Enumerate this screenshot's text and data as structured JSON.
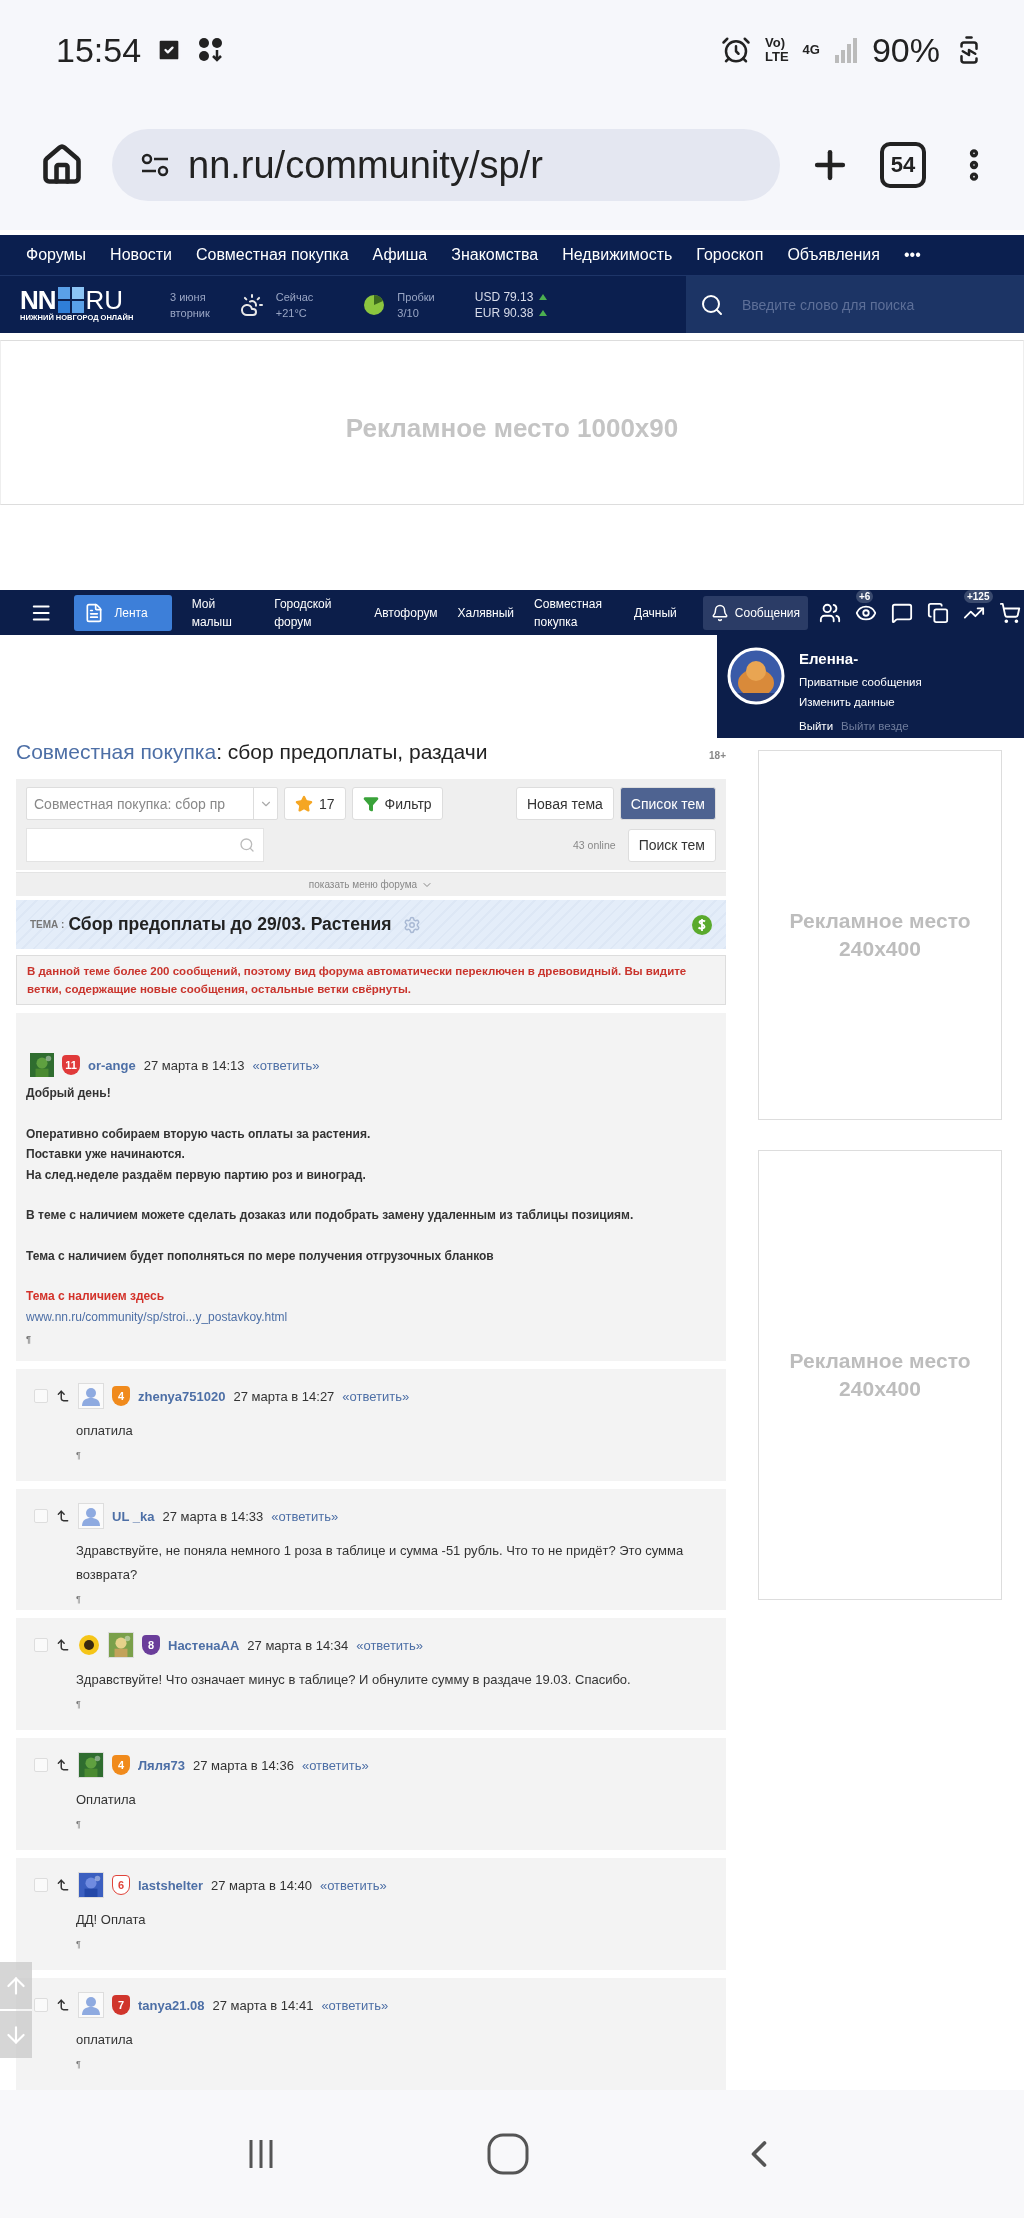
{
  "status_bar": {
    "time": "15:54",
    "volte_top": "Vo)",
    "volte_bottom": "LTE",
    "network": "4G",
    "battery": "90%"
  },
  "browser": {
    "url": "nn.ru/community/sp/r",
    "tab_count": "54"
  },
  "site_nav": {
    "items": [
      "Форумы",
      "Новости",
      "Совместная покупка",
      "Афиша",
      "Знакомства",
      "Недвижимость",
      "Гороскоп",
      "Объявления"
    ],
    "more": "•••"
  },
  "info_bar": {
    "logo_left": "NN",
    "logo_right": "RU",
    "logo_caption": "НИЖНИЙ НОВГОРОД ОНЛАЙН",
    "date": "3 июня",
    "weekday": "вторник",
    "weather_label": "Сейчас",
    "weather_value": "+21°C",
    "traffic_label": "Пробки",
    "traffic_value": "3/10",
    "rates": [
      {
        "text": "USD 79.13",
        "kind": "rising"
      },
      {
        "text": "EUR 90.38",
        "kind": "rising"
      }
    ],
    "search_placeholder": "Введите слово для поиска"
  },
  "ad_banner": "Рекламное место 1000x90",
  "forum_nav": {
    "items": [
      {
        "label": "Лента",
        "selected": true
      },
      {
        "label": "Мой малыш",
        "selected": false
      },
      {
        "label": "Городской форум",
        "selected": false
      },
      {
        "label": "Автофорум",
        "selected": false
      },
      {
        "label": "Халявный",
        "selected": false
      },
      {
        "label": "Совместная покупка",
        "selected": false
      },
      {
        "label": "Дачный",
        "selected": false
      }
    ],
    "messages": "Сообщения",
    "icons": [
      {
        "kind": "people"
      },
      {
        "kind": "eye",
        "badge": "+6"
      },
      {
        "kind": "chat"
      },
      {
        "kind": "squares"
      },
      {
        "kind": "trend",
        "badge": "+125"
      },
      {
        "kind": "cart"
      }
    ]
  },
  "user_menu": {
    "name": "Еленна-",
    "links": [
      "Приватные сообщения",
      "Изменить данные"
    ],
    "logout": "Выйти",
    "logout_all": "Выйти везде"
  },
  "forum": {
    "section_link": "Совместная покупка",
    "title_rest": ": сбор предоплаты, раздачи",
    "age": "18+",
    "select_value": "Совместная покупка: сбор пр",
    "favorites": "17",
    "filter": "Фильтр",
    "new_topic": "Новая тема",
    "topic_list": "Список тем",
    "online": "43 online",
    "search_topics": "Поиск тем",
    "show_menu": "показать меню форума"
  },
  "topic": {
    "label": "ТЕМА :",
    "title": "Сбор предоплаты до 29/03. Растения",
    "notice": "В данной теме более 200 сообщений, поэтому вид форума автоматически переключен в древовидный. Вы видите ветки, содержащие новые сообщения, остальные ветки свёрнуты."
  },
  "post": {
    "author": "or-ange",
    "badge": {
      "number": "11",
      "color": "#e03a3a",
      "outline": false
    },
    "date": "27 марта в 14:13",
    "reply": "«ответить»",
    "paragraphs": [
      [
        "Добрый день!"
      ],
      [
        "Оперативно собираем вторую часть оплаты за растения.",
        "Поставки уже начинаются.",
        "На след.неделе раздаём первую партию роз и виноград."
      ],
      [
        "В теме с наличием можете сделать дозаказ или подобрать замену удаленным из таблицы позициям."
      ],
      [
        "Тема с наличием будет пополняться по мере получения отгрузочных бланков"
      ]
    ],
    "highlight": "Тема с наличием здесь",
    "link": "www.nn.ru/community/sp/stroi...y_postavkoy.html",
    "pilcrow": "¶"
  },
  "comments": [
    {
      "author": "zhenya751020",
      "kind": "silhouette",
      "flower": false,
      "badge": {
        "number": "4",
        "color": "#f08a1c",
        "outline": false
      },
      "date": "27 марта в 14:27",
      "reply": "«ответить»",
      "text": "оплатила",
      "pilcrow": "¶"
    },
    {
      "author": "UL _ka",
      "kind": "silhouette",
      "flower": false,
      "date": "27 марта в 14:33",
      "reply": "«ответить»",
      "text": "Здравствуйте, не поняла немного 1 роза в таблице и сумма -51 рубль. Что то не придёт? Это сумма возврата?",
      "pilcrow": "¶"
    },
    {
      "author": "НастенаАА",
      "flower": true,
      "badge": {
        "number": "8",
        "color": "#6a3d9a",
        "outline": false
      },
      "date": "27 марта в 14:34",
      "reply": "«ответить»",
      "text": "Здравствуйте! Что означает минус в таблице? И обнулите сумму в раздаче 19.03. Спасибо.",
      "pilcrow": "¶"
    },
    {
      "author": "Ляля73",
      "flower": false,
      "badge": {
        "number": "4",
        "color": "#f08a1c",
        "outline": false
      },
      "date": "27 марта в 14:36",
      "reply": "«ответить»",
      "text": "Оплатила",
      "pilcrow": "¶"
    },
    {
      "author": "lastshelter",
      "flower": false,
      "badge": {
        "number": "6",
        "color": "#e0443a",
        "outline": true
      },
      "date": "27 марта в 14:40",
      "reply": "«ответить»",
      "text": "ДД! Оплата",
      "pilcrow": "¶"
    },
    {
      "author": "tanya21.08",
      "kind": "silhouette",
      "flower": false,
      "badge": {
        "number": "7",
        "color": "#d0352c",
        "outline": false
      },
      "date": "27 марта в 14:41",
      "reply": "«ответить»",
      "text": "оплатила",
      "pilcrow": "¶"
    }
  ],
  "side_ads": [
    "Рекламное место 240x400",
    "Рекламное место 240x400"
  ]
}
